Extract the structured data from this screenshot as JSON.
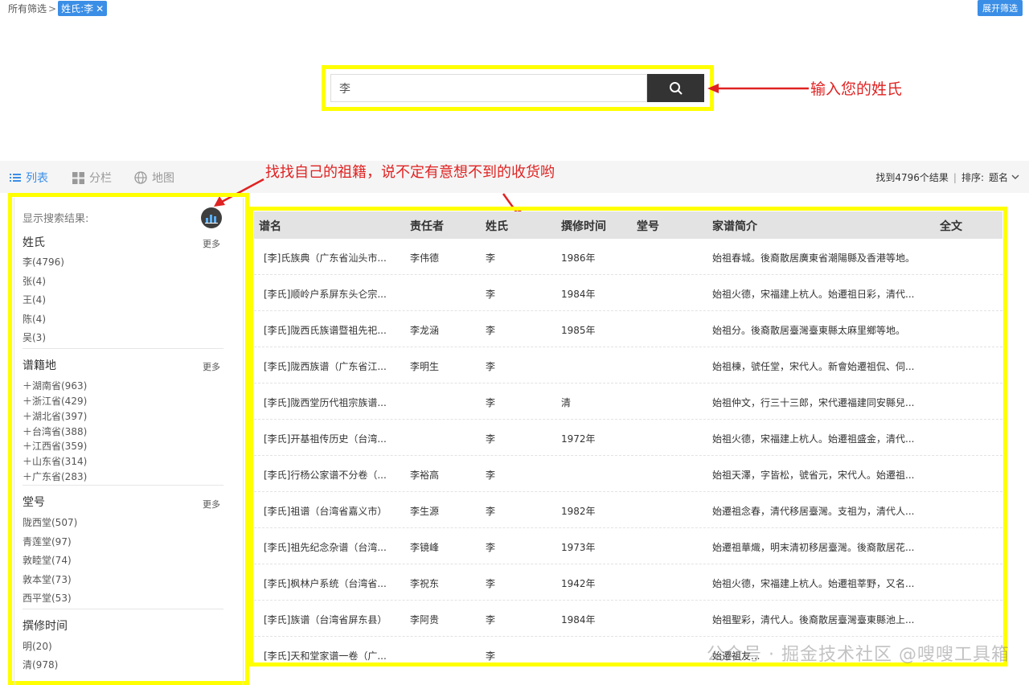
{
  "breadcrumb": {
    "root": "所有筛选",
    "chevron": ">",
    "chip_label": "姓氏:李",
    "chip_close": "✕"
  },
  "expand_button": "展开筛选",
  "search": {
    "value": "李",
    "icon": "search-icon"
  },
  "annotations": {
    "search_note": "输入您的姓氏",
    "sidebar_note": "找找自己的祖籍，说不定有意想不到的收货哟"
  },
  "view_tabs": [
    {
      "label": "列表",
      "icon": "list-icon"
    },
    {
      "label": "分栏",
      "icon": "grid-icon"
    },
    {
      "label": "地图",
      "icon": "globe-icon"
    }
  ],
  "results": {
    "count_text": "找到4796个结果",
    "sep": "|",
    "sort_label": "排序:",
    "sort_value": "题名"
  },
  "sidebar": {
    "title": "显示搜索结果:",
    "chart_icon": "bar-chart-icon",
    "facets": [
      {
        "title": "姓氏",
        "more": "更多",
        "items": [
          "李(4796)",
          "张(4)",
          "王(4)",
          "陈(4)",
          "吴(3)"
        ]
      },
      {
        "title": "谱籍地",
        "more": "更多",
        "items": [
          "＋湖南省(963)",
          "＋浙江省(429)",
          "＋湖北省(397)",
          "＋台湾省(388)",
          "＋江西省(359)",
          "＋山东省(314)",
          "＋广东省(283)"
        ]
      },
      {
        "title": "堂号",
        "more": "更多",
        "items": [
          "陇西堂(507)",
          "青莲堂(97)",
          "敦睦堂(74)",
          "敦本堂(73)",
          "西平堂(53)"
        ]
      },
      {
        "title": "撰修时间",
        "more": "",
        "items": [
          "明(20)",
          "清(978)"
        ]
      }
    ]
  },
  "table": {
    "headers": [
      "谱名",
      "责任者",
      "姓氏",
      "撰修时间",
      "堂号",
      "家谱简介",
      "全文"
    ],
    "rows": [
      [
        "[李]氏族典（广东省汕头市...",
        "李伟德",
        "李",
        "1986年",
        "",
        "始祖春城。後裔散居廣東省潮陽縣及香港等地。",
        ""
      ],
      [
        "[李氏]顺岭户系屏东头仑宗...",
        "",
        "李",
        "1984年",
        "",
        "始祖火德，宋福建上杭人。始遷祖日彩，清代...",
        ""
      ],
      [
        "[李氏]陇西氏族谱暨祖先祀...",
        "李龙涵",
        "李",
        "1985年",
        "",
        "始祖分。後裔散居臺灣臺東縣太麻里鄉等地。",
        ""
      ],
      [
        "[李氏]陇西族谱（广东省江...",
        "李明生",
        "李",
        "",
        "",
        "始祖棟，號任堂，宋代人。新會始遷祖侃、伺...",
        ""
      ],
      [
        "[李氏]陇西堂历代祖宗族谱...",
        "",
        "李",
        "清",
        "",
        "始祖仲文，行三十三郎，宋代遷福建同安縣兒...",
        ""
      ],
      [
        "[李氏]开基祖传历史（台湾...",
        "",
        "李",
        "1972年",
        "",
        "始祖火德，宋福建上杭人。始遷祖盛金，清代...",
        ""
      ],
      [
        "[李氏]行杨公家谱不分卷（...",
        "李裕高",
        "李",
        "",
        "",
        "始祖天澤，字皆松，號省元，宋代人。始遷祖...",
        ""
      ],
      [
        "[李氏]祖谱（台湾省嘉义市）",
        "李生源",
        "李",
        "1982年",
        "",
        "始遷祖念春，清代移居臺灣。支祖为，清代人...",
        ""
      ],
      [
        "[李氏]祖先纪念杂谱（台湾...",
        "李镜峰",
        "李",
        "1973年",
        "",
        "始遷祖華熾，明末清初移居臺灣。後裔散居花...",
        ""
      ],
      [
        "[李氏]枫林户系统（台湾省...",
        "李祝东",
        "李",
        "1942年",
        "",
        "始祖火德，宋福建上杭人。始遷祖莘野，又名...",
        ""
      ],
      [
        "[李氏]族谱（台湾省屏东县）",
        "李阿贵",
        "李",
        "1984年",
        "",
        "始祖聖彩，清代人。後裔散居臺灣臺東縣池上...",
        ""
      ],
      [
        "[李氏]天和堂家谱一卷（广...",
        "",
        "李",
        "",
        "",
        "始遷祖友...",
        ""
      ]
    ]
  },
  "watermark": "公众号 · 掘金技术社区 @嗖嗖工具箱",
  "colors": {
    "accent": "#3a8ee6",
    "highlight": "#ffff00",
    "annotation": "#e02222",
    "search_button": "#333333"
  }
}
